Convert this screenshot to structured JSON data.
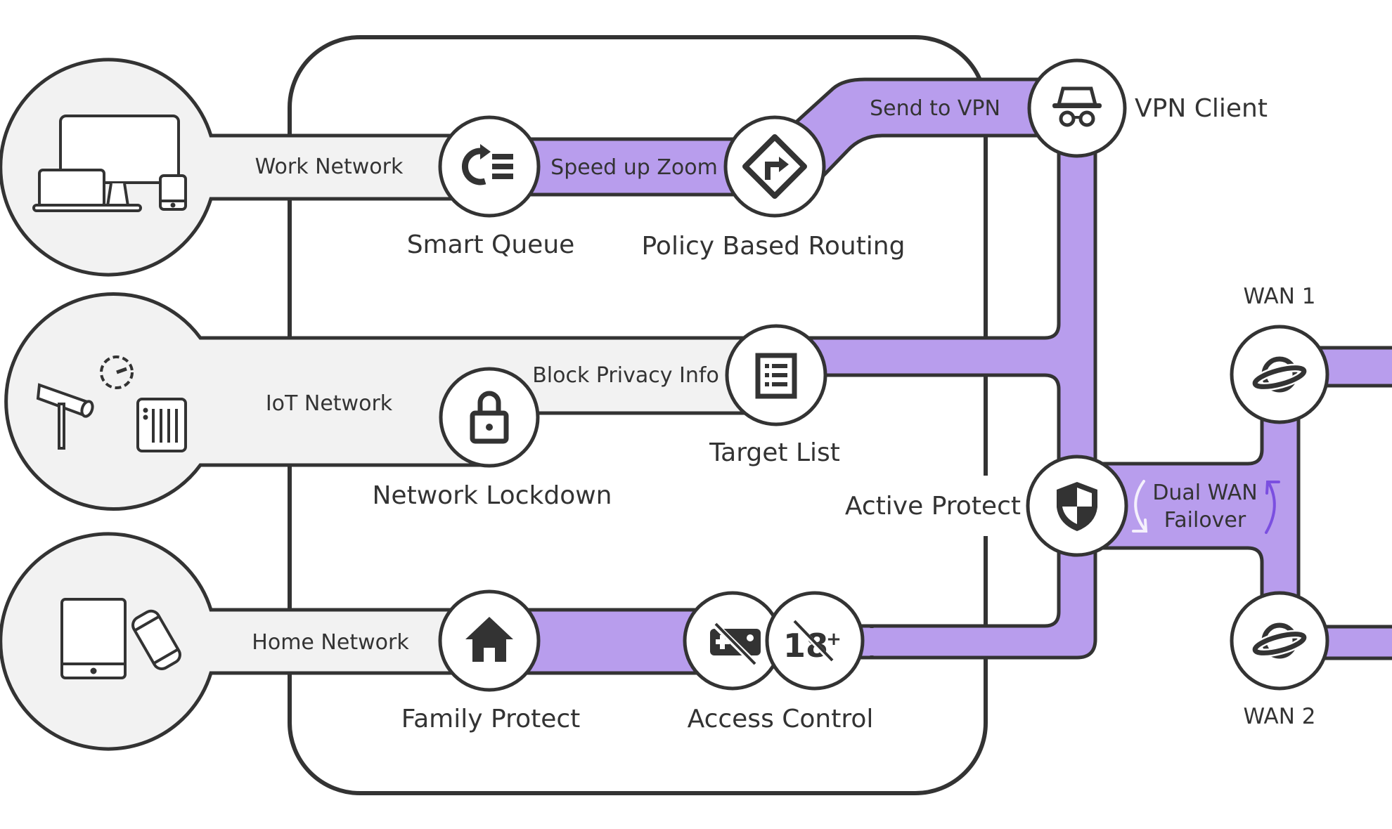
{
  "colors": {
    "accent_purple": "#b89ded",
    "stroke_dark": "#333333",
    "band_gray": "#f2f2f2",
    "node_fill": "#ffffff",
    "arrow_light": "#f4f0fc",
    "arrow_dark": "#7b4fe0"
  },
  "networks": [
    {
      "id": "work",
      "label": "Work Network",
      "icon": "desktop-laptop-phone-icon"
    },
    {
      "id": "iot",
      "label": "IoT Network",
      "icon": "camera-gauge-speaker-icon"
    },
    {
      "id": "home",
      "label": "Home Network",
      "icon": "tablet-phone-icon"
    }
  ],
  "bands": {
    "speed_up_zoom": "Speed up Zoom",
    "send_to_vpn": "Send to VPN",
    "block_privacy_info": "Block Privacy Info",
    "dual_wan_failover_line1": "Dual WAN",
    "dual_wan_failover_line2": "Failover"
  },
  "features": {
    "smart_queue": {
      "label": "Smart Queue",
      "icon": "smart-queue-icon"
    },
    "policy_based_routing": {
      "label": "Policy Based Routing",
      "icon": "route-sign-icon"
    },
    "vpn_client": {
      "label": "VPN Client",
      "icon": "incognito-icon"
    },
    "network_lockdown": {
      "label": "Network Lockdown",
      "icon": "lock-icon"
    },
    "target_list": {
      "label": "Target List",
      "icon": "list-icon"
    },
    "active_protect": {
      "label": "Active Protect",
      "icon": "shield-icon"
    },
    "family_protect": {
      "label": "Family Protect",
      "icon": "home-icon"
    },
    "access_control": {
      "label": "Access Control",
      "icons": [
        "no-gaming-icon",
        "no-adult-content-icon"
      ]
    }
  },
  "wan": [
    {
      "label": "WAN 1",
      "icon": "planet-icon"
    },
    {
      "label": "WAN 2",
      "icon": "planet-icon"
    }
  ]
}
